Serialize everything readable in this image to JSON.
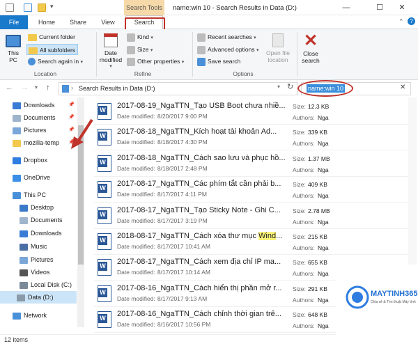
{
  "window": {
    "title": "name:win 10 - Search Results in Data (D:)",
    "context_tab": "Search Tools",
    "minimize": "—",
    "maximize": "☐",
    "close": "✕"
  },
  "ribbon_tabs": [
    "File",
    "Home",
    "Share",
    "View",
    "Search"
  ],
  "ribbon": {
    "location": {
      "this_pc": "This PC",
      "current_folder": "Current folder",
      "all_subfolders": "All subfolders",
      "search_again": "Search again in",
      "group": "Location"
    },
    "refine": {
      "date_modified": "Date modified",
      "kind": "Kind",
      "size": "Size",
      "other_properties": "Other properties",
      "group": "Refine"
    },
    "options": {
      "recent_searches": "Recent searches",
      "advanced_options": "Advanced options",
      "save_search": "Save search",
      "open_file_location": "Open file location",
      "group": "Options"
    },
    "close_search": "Close search"
  },
  "address": {
    "path": "Search Results in Data (D:)",
    "search_value": "name:win 10"
  },
  "nav": {
    "items": [
      {
        "label": "Downloads",
        "pinned": true,
        "color": "#3a7bd5"
      },
      {
        "label": "Documents",
        "pinned": true,
        "color": "#9fb5cc"
      },
      {
        "label": "Pictures",
        "pinned": true,
        "color": "#7aa7d8"
      },
      {
        "label": "mozilla-temp",
        "pinned": true,
        "color": "#f2c94c"
      },
      {
        "label": "Dropbox",
        "pinned": false,
        "color": "#2f7de1"
      },
      {
        "label": "OneDrive",
        "pinned": false,
        "color": "#3a8ee6"
      },
      {
        "label": "This PC",
        "pinned": false,
        "color": "#4a90d9"
      },
      {
        "label": "Desktop",
        "pinned": false,
        "color": "#3b79c9"
      },
      {
        "label": "Documents",
        "pinned": false,
        "color": "#9fb5cc"
      },
      {
        "label": "Downloads",
        "pinned": false,
        "color": "#3a7bd5"
      },
      {
        "label": "Music",
        "pinned": false,
        "color": "#4a6fa5"
      },
      {
        "label": "Pictures",
        "pinned": false,
        "color": "#7aa7d8"
      },
      {
        "label": "Videos",
        "pinned": false,
        "color": "#555555"
      },
      {
        "label": "Local Disk (C:)",
        "pinned": false,
        "color": "#7a8a99"
      },
      {
        "label": "Data (D:)",
        "pinned": false,
        "color": "#8a9aa9",
        "selected": true
      },
      {
        "label": "Network",
        "pinned": false,
        "color": "#4a90d9"
      }
    ]
  },
  "results": {
    "size_label": "Size:",
    "authors_label": "Authors:",
    "date_label": "Date modified:",
    "items": [
      {
        "name": "2017-08-19_NgaTTN_Tạo USB Boot chưa nhiề...",
        "date": "8/20/2017 9:00 PM",
        "size": "12.3 KB",
        "author": "Nga"
      },
      {
        "name": "2017-08-18_NgaTTN_Kích hoạt tài khoản Ad...",
        "date": "8/18/2017 4:30 PM",
        "size": "339 KB",
        "author": "Nga"
      },
      {
        "name": "2017-08-18_NgaTTN_Cách sao lưu và phục hồ...",
        "date": "8/18/2017 2:48 PM",
        "size": "1.37 MB",
        "author": "Nga"
      },
      {
        "name": "2017-08-17_NgaTTN_Các phím tắt cần phải b...",
        "date": "8/17/2017 4:11 PM",
        "size": "409 KB",
        "author": "Nga"
      },
      {
        "name": "2017-08-17_NgaTTN_Tạo Sticky Note - Ghi C...",
        "date": "8/17/2017 3:19 PM",
        "size": "2.78 MB",
        "author": "Nga"
      },
      {
        "name_pre": "2018-08-17_NgaTTN_Cách xóa thư mục ",
        "name_hl": "Wind",
        "name_post": "...",
        "date": "8/17/2017 10:41 AM",
        "size": "215 KB",
        "author": "Nga"
      },
      {
        "name": "2017-08-17_NgaTTN_Cách xem địa chỉ IP ma...",
        "date": "8/17/2017 10:14 AM",
        "size": "655 KB",
        "author": "Nga"
      },
      {
        "name": "2017-08-16_NgaTTN_Cách hiển thị phần mở r...",
        "date": "8/17/2017 9:13 AM",
        "size": "291 KB",
        "author": "Nga"
      },
      {
        "name": "2017-08-16_NgaTTN_Cách chỉnh thời gian trê...",
        "date": "8/16/2017 10:56 PM",
        "size": "648 KB",
        "author": "Nga"
      }
    ]
  },
  "status": {
    "count": "12 items"
  },
  "watermark": {
    "brand": "MAYTINH365",
    "tagline": "Chia sẻ & Tìm thuật Máy tính"
  },
  "colors": {
    "accent": "#1979ca",
    "annotation": "#c0332b",
    "word": "#2b5797"
  }
}
